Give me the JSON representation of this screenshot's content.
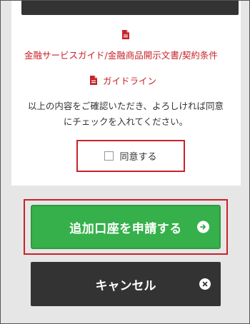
{
  "documents": {
    "services_guide": "金融サービスガイド/金融商品開示文書/契約条件",
    "guideline": "ガイドライン"
  },
  "consent": {
    "line1": "以上の内容をご確認いただき、よろしければ同意",
    "line2": "にチェックを入れてください。",
    "checkbox_label": "同意する",
    "checked": false
  },
  "actions": {
    "apply_label": "追加口座を申請する",
    "cancel_label": "キャンセル"
  },
  "colors": {
    "accent_red": "#c7232a",
    "apply_green": "#36b04a",
    "cancel_dark": "#333333"
  },
  "icons": {
    "document": "pdf-document-icon",
    "apply": "arrow-right-circle-icon",
    "cancel": "close-circle-icon"
  }
}
